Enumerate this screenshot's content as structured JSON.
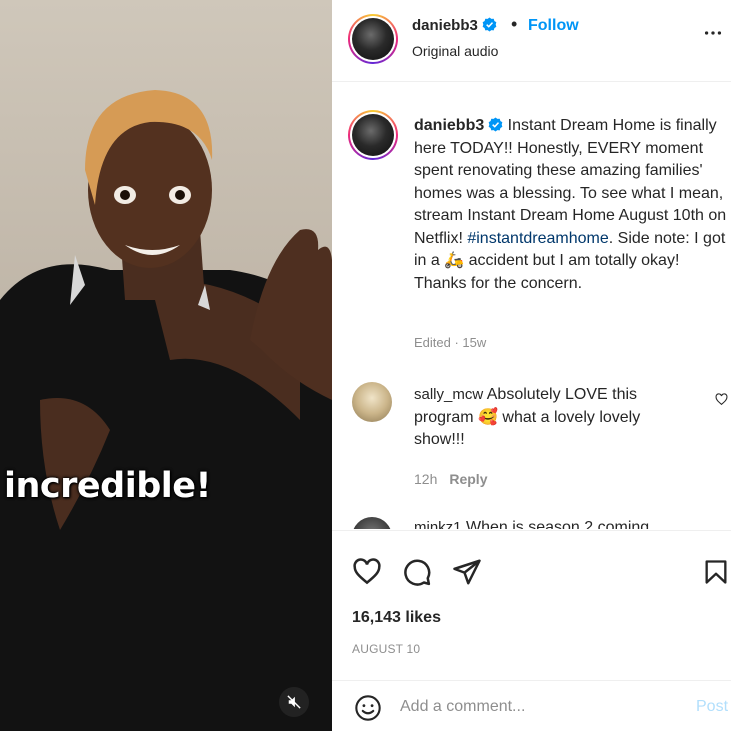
{
  "media": {
    "overlay_text": "incredible!"
  },
  "header": {
    "username": "daniebb3",
    "separator": "•",
    "follow_label": "Follow",
    "audio_label": "Original audio"
  },
  "caption": {
    "username": "daniebb3",
    "text_before_hashtag": " Instant Dream Home is finally here TODAY!! Honestly, EVERY moment spent renovating these amazing families' homes was a blessing. To see what I mean, stream Instant Dream Home August 10th on Netflix! ",
    "hashtag": "#instantdreamhome",
    "text_after_hashtag": ". Side note: I got in a ",
    "emoji": "🛵",
    "text_end": " accident but I am totally okay! Thanks for the concern.",
    "meta": "Edited · 15w"
  },
  "comments": [
    {
      "username": "sally_mcw",
      "text": " Absolutely LOVE this program 🥰 what a lovely lovely show!!!",
      "time": "12h",
      "reply_label": "Reply"
    },
    {
      "username": "minkz1",
      "text": " When is season 2 coming"
    }
  ],
  "actions": {
    "likes": "16,143 likes",
    "date": "AUGUST 10"
  },
  "add_comment": {
    "placeholder": "Add a comment...",
    "post_label": "Post"
  },
  "colors": {
    "accent": "#0095f6",
    "text": "#262626",
    "muted": "#8e8e8e",
    "post_disabled": "#b2dffc",
    "hashtag": "#00376b"
  }
}
